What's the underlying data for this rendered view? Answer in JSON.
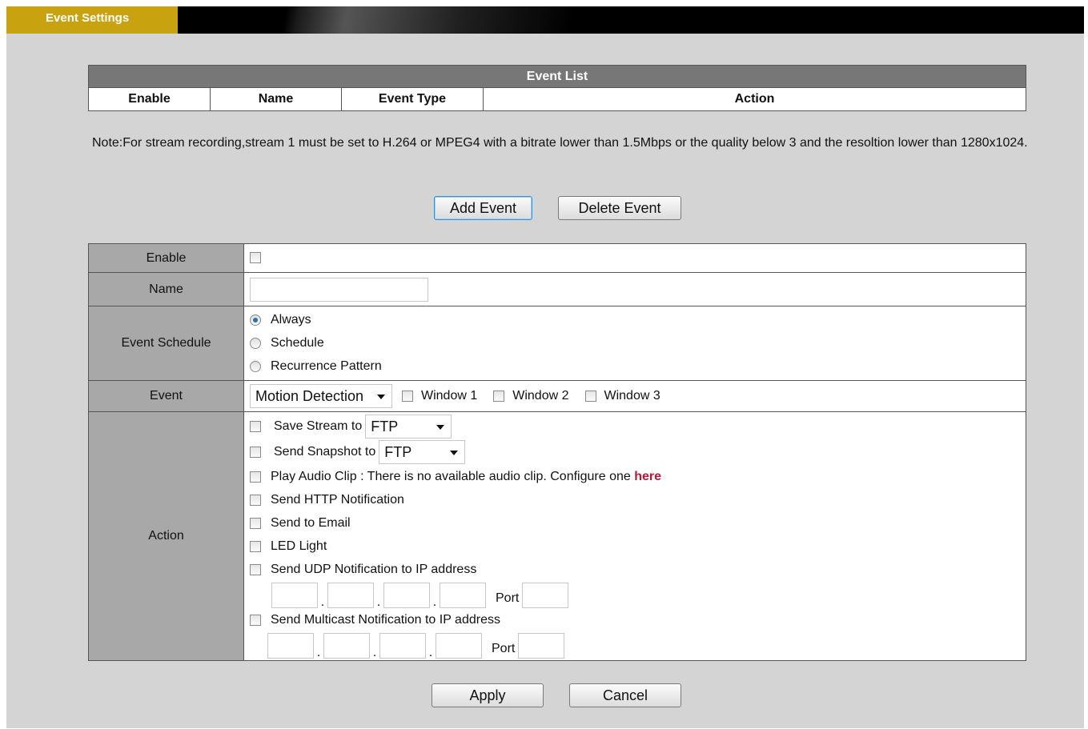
{
  "header": {
    "tab_label": "Event Settings"
  },
  "event_list": {
    "caption": "Event List",
    "columns": [
      "Enable",
      "Name",
      "Event Type",
      "Action"
    ]
  },
  "note": "Note:For stream recording,stream 1 must be set to H.264 or MPEG4 with a bitrate lower than 1.5Mbps or the quality below 3 and the resoltion lower than 1280x1024.",
  "buttons": {
    "add": "Add Event",
    "delete": "Delete Event",
    "apply": "Apply",
    "cancel": "Cancel"
  },
  "form": {
    "enable": {
      "label": "Enable",
      "checked": false
    },
    "name": {
      "label": "Name",
      "value": ""
    },
    "schedule": {
      "label": "Event Schedule",
      "options": [
        "Always",
        "Schedule",
        "Recurrence Pattern"
      ],
      "selected": "Always"
    },
    "event": {
      "label": "Event",
      "type": "Motion Detection",
      "windows": [
        "Window 1",
        "Window 2",
        "Window 3"
      ]
    },
    "action": {
      "label": "Action",
      "save_stream": {
        "label": "Save Stream to",
        "target": "FTP"
      },
      "send_snapshot": {
        "label": "Send Snapshot to",
        "target": "FTP"
      },
      "play_audio": {
        "label": "Play Audio Clip : There is no available audio clip. Configure one",
        "link": "here"
      },
      "http": "Send HTTP Notification",
      "email": "Send to Email",
      "led": "LED Light",
      "udp": {
        "label": "Send UDP Notification to IP address",
        "port_label": "Port",
        "octets": [
          "",
          "",
          "",
          ""
        ],
        "port": ""
      },
      "multicast": {
        "label": "Send Multicast Notification to IP address",
        "port_label": "Port",
        "octets": [
          "",
          "",
          "",
          ""
        ],
        "port": ""
      }
    }
  },
  "colors": {
    "accent": "#c9a20f",
    "header_bg": "#000000",
    "panel_bg": "#d4d4d4",
    "label_bg": "#a8a8a8",
    "link": "#b8193a"
  }
}
